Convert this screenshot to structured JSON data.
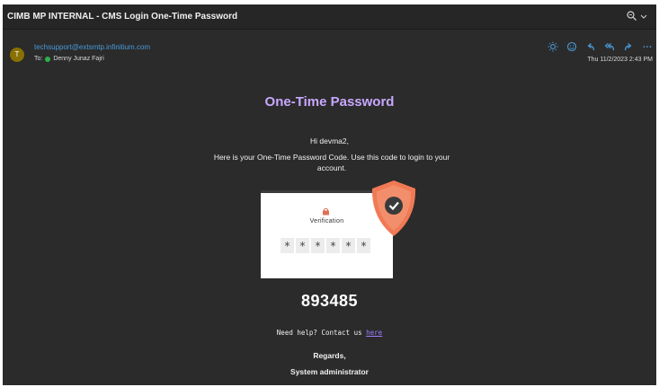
{
  "window": {
    "title": "CIMB MP INTERNAL - CMS Login One-Time Password"
  },
  "header": {
    "avatar_initial": "T",
    "sender": "techsupport@extsmtp.infinitium.com",
    "to_prefix": "To:",
    "recipient": "Denny Junaz Fajri",
    "date": "Thu 11/2/2023 2:43 PM"
  },
  "icons": {
    "zoom": "zoom-icon",
    "sun": "sun-icon",
    "emoji": "emoji-icon",
    "reply": "reply-icon",
    "reply_all": "reply-all-icon",
    "forward": "forward-icon",
    "more": "more-icon"
  },
  "body": {
    "title": "One-Time Password",
    "greeting": "Hi devma2,",
    "message": "Here is your One-Time Password Code. Use this code to login to your account.",
    "illustration": {
      "verification_label": "Verification",
      "pin_boxes": [
        "*",
        "*",
        "*",
        "*",
        "*",
        "*"
      ]
    },
    "otp_code": "893485",
    "help_text": "Need help? Contact us",
    "help_link": "here",
    "regards": "Regards,",
    "signature": "System administrator"
  },
  "colors": {
    "background": "#2b2b2b",
    "title_accent": "#c8a8ff",
    "link": "#9d7dff",
    "sender_link": "#4a9ad8",
    "shield": "#f07a55",
    "action_icons": "#4a9ad8"
  }
}
